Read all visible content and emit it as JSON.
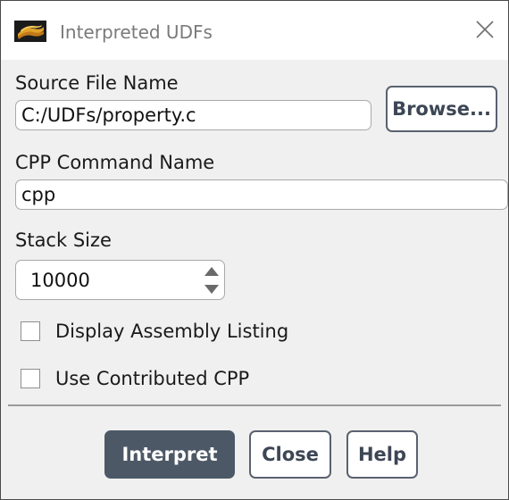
{
  "window": {
    "title": "Interpreted UDFs",
    "app_icon": "fluent-logo-icon",
    "close_icon": "close-icon"
  },
  "source_file": {
    "label": "Source File Name",
    "value": "C:/UDFs/property.c",
    "browse_label": "Browse..."
  },
  "cpp_command": {
    "label": "CPP Command Name",
    "value": "cpp"
  },
  "stack_size": {
    "label": "Stack Size",
    "value": "10000",
    "up_icon": "spin-up-icon",
    "down_icon": "spin-down-icon"
  },
  "options": {
    "display_assembly": {
      "label": "Display Assembly Listing",
      "checked": false
    },
    "use_contributed_cpp": {
      "label": "Use Contributed CPP",
      "checked": false
    }
  },
  "buttons": {
    "interpret": "Interpret",
    "close": "Close",
    "help": "Help"
  },
  "colors": {
    "primary_button": "#4d5867",
    "secondary_button_text": "#3d4654",
    "title_text": "#7a7a7a"
  }
}
